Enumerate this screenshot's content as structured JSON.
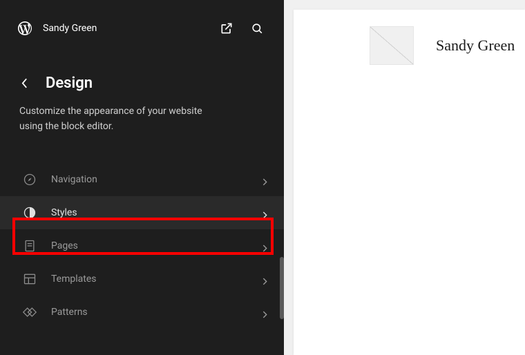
{
  "site_name": "Sandy Green",
  "heading": "Design",
  "description": "Customize the appearance of your website using the block editor.",
  "menu": {
    "navigation": "Navigation",
    "styles": "Styles",
    "pages": "Pages",
    "templates": "Templates",
    "patterns": "Patterns"
  },
  "preview": {
    "title": "Sandy Green"
  }
}
